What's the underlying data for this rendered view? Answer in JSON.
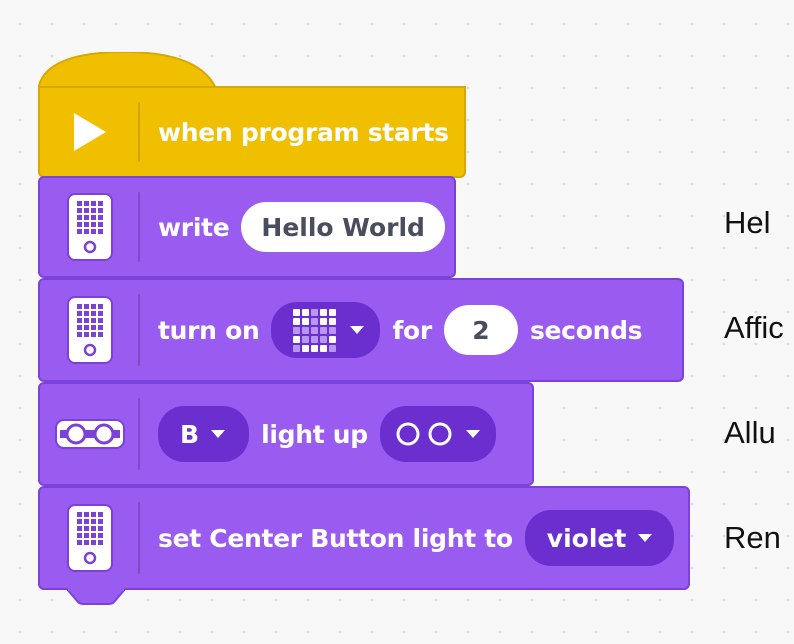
{
  "blocks": {
    "hat": {
      "label": "when program starts"
    },
    "write": {
      "label": "write",
      "value": "Hello World"
    },
    "turn_on": {
      "label": "turn on",
      "for_label": "for",
      "seconds_value": "2",
      "seconds_label": "seconds"
    },
    "light_up": {
      "port": "B",
      "label": "light up"
    },
    "center_button": {
      "label": "set Center Button light to",
      "color_value": "violet"
    }
  },
  "side_list": [
    "Hel",
    "Affic",
    "Allu",
    "Ren"
  ],
  "icons": {
    "hat": "play-triangle-icon",
    "hub": "hub-icon",
    "ultrasonic": "distance-sensor-icon",
    "pattern": "light-matrix-pattern-icon",
    "eyes": "sensor-eyes-icon"
  },
  "colors": {
    "events_yellow": "#f0c000",
    "light_purple": "#9a5cf0",
    "dropdown_purple": "#6b2fcf",
    "text_grey": "#4a4d5e"
  }
}
